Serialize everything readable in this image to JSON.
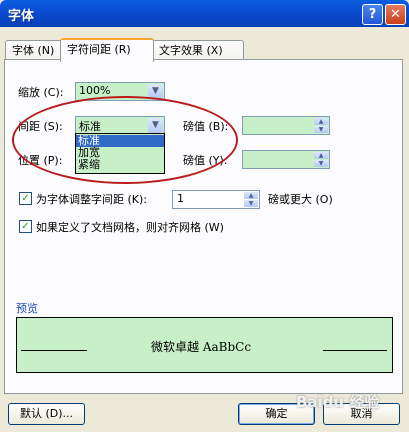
{
  "window": {
    "title": "字体",
    "help_label": "?",
    "close_label": "✕"
  },
  "tabs": [
    {
      "label": "字体 (N)"
    },
    {
      "label": "字符间距 (R)"
    },
    {
      "label": "文字效果 (X)"
    }
  ],
  "fields": {
    "scale": {
      "label": "缩放 (C):",
      "value": "100%"
    },
    "spacing": {
      "label": "间距 (S):",
      "value": "标准"
    },
    "spacing_points": {
      "label": "磅值 (B):",
      "value": ""
    },
    "position": {
      "label": "位置 (P):",
      "value": ""
    },
    "position_points": {
      "label": "磅值 (Y):",
      "value": ""
    }
  },
  "spacing_dropdown": {
    "options": [
      "标准",
      "加宽",
      "紧缩"
    ],
    "selected": "标准"
  },
  "kerning": {
    "label": "为字体调整字间距 (K):",
    "value": "1",
    "suffix": "磅或更大 (O)",
    "checked": true
  },
  "grid": {
    "label": "如果定义了文档网格，则对齐网格 (W)",
    "checked": true
  },
  "preview": {
    "label": "预览",
    "text": "微软卓越  AaBbCc"
  },
  "buttons": {
    "default": "默认 (D)...",
    "ok": "确定",
    "cancel": "取消"
  },
  "watermark": "Baidu 经验",
  "colors": {
    "title_bar": "#0a4ad0",
    "field_bg": "#c8f0c8",
    "highlight": "#316ac5",
    "annotation": "#b81c1c"
  }
}
